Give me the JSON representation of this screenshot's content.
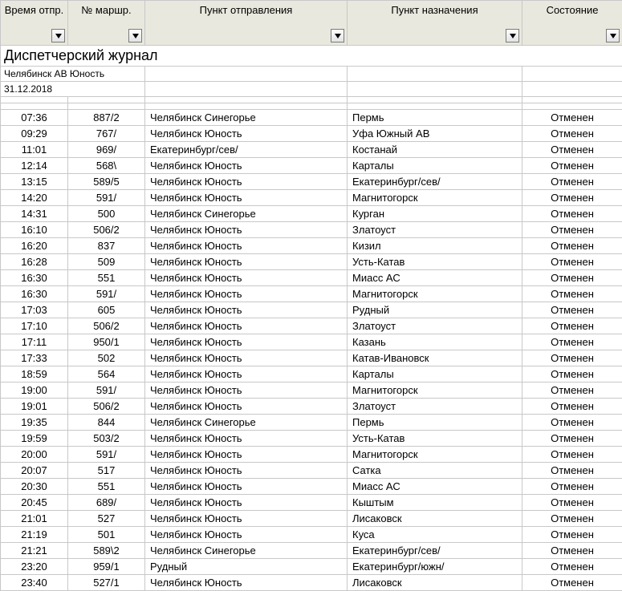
{
  "header": {
    "title": "Диспетчерский журнал",
    "station": "Челябинск АВ Юность",
    "date": "31.12.2018"
  },
  "columns": {
    "time": "Время отпр.",
    "route": "№ маршр.",
    "departure": "Пункт отправления",
    "destination": "Пункт назначения",
    "status": "Состояние"
  },
  "chart_data": {
    "type": "table",
    "columns": [
      "Время отпр.",
      "№ маршр.",
      "Пункт отправления",
      "Пункт назначения",
      "Состояние"
    ],
    "rows": [
      {
        "time": "07:36",
        "route": "887/2",
        "dep": "Челябинск Синегорье",
        "dest": "Пермь",
        "status": "Отменен"
      },
      {
        "time": "09:29",
        "route": "767/",
        "dep": "Челябинск Юность",
        "dest": "Уфа Южный АВ",
        "status": "Отменен"
      },
      {
        "time": "11:01",
        "route": "969/",
        "dep": "Екатеринбург/сев/",
        "dest": "Костанай",
        "status": "Отменен"
      },
      {
        "time": "12:14",
        "route": "568\\",
        "dep": "Челябинск Юность",
        "dest": "Карталы",
        "status": "Отменен"
      },
      {
        "time": "13:15",
        "route": "589/5",
        "dep": "Челябинск Юность",
        "dest": "Екатеринбург/сев/",
        "status": "Отменен"
      },
      {
        "time": "14:20",
        "route": "591/",
        "dep": "Челябинск Юность",
        "dest": "Магнитогорск",
        "status": "Отменен"
      },
      {
        "time": "14:31",
        "route": "500",
        "dep": "Челябинск Синегорье",
        "dest": "Курган",
        "status": "Отменен"
      },
      {
        "time": "16:10",
        "route": "506/2",
        "dep": "Челябинск Юность",
        "dest": "Златоуст",
        "status": "Отменен"
      },
      {
        "time": "16:20",
        "route": "837",
        "dep": "Челябинск Юность",
        "dest": "Кизил",
        "status": "Отменен"
      },
      {
        "time": "16:28",
        "route": "509",
        "dep": "Челябинск Юность",
        "dest": "Усть-Катав",
        "status": "Отменен"
      },
      {
        "time": "16:30",
        "route": "551",
        "dep": "Челябинск Юность",
        "dest": "Миасс АС",
        "status": "Отменен"
      },
      {
        "time": "16:30",
        "route": "591/",
        "dep": "Челябинск Юность",
        "dest": "Магнитогорск",
        "status": "Отменен"
      },
      {
        "time": "17:03",
        "route": "605",
        "dep": "Челябинск Юность",
        "dest": "Рудный",
        "status": "Отменен"
      },
      {
        "time": "17:10",
        "route": "506/2",
        "dep": "Челябинск Юность",
        "dest": "Златоуст",
        "status": "Отменен"
      },
      {
        "time": "17:11",
        "route": "950/1",
        "dep": "Челябинск Юность",
        "dest": "Казань",
        "status": "Отменен"
      },
      {
        "time": "17:33",
        "route": "502",
        "dep": "Челябинск Юность",
        "dest": "Катав-Ивановск",
        "status": "Отменен"
      },
      {
        "time": "18:59",
        "route": "564",
        "dep": "Челябинск Юность",
        "dest": "Карталы",
        "status": "Отменен"
      },
      {
        "time": "19:00",
        "route": "591/",
        "dep": "Челябинск Юность",
        "dest": "Магнитогорск",
        "status": "Отменен"
      },
      {
        "time": "19:01",
        "route": "506/2",
        "dep": "Челябинск Юность",
        "dest": "Златоуст",
        "status": "Отменен"
      },
      {
        "time": "19:35",
        "route": "844",
        "dep": "Челябинск Синегорье",
        "dest": "Пермь",
        "status": "Отменен"
      },
      {
        "time": "19:59",
        "route": "503/2",
        "dep": "Челябинск Юность",
        "dest": "Усть-Катав",
        "status": "Отменен"
      },
      {
        "time": "20:00",
        "route": "591/",
        "dep": "Челябинск Юность",
        "dest": "Магнитогорск",
        "status": "Отменен"
      },
      {
        "time": "20:07",
        "route": "517",
        "dep": "Челябинск Юность",
        "dest": "Сатка",
        "status": "Отменен"
      },
      {
        "time": "20:30",
        "route": "551",
        "dep": "Челябинск Юность",
        "dest": "Миасс АС",
        "status": "Отменен"
      },
      {
        "time": "20:45",
        "route": "689/",
        "dep": "Челябинск Юность",
        "dest": "Кыштым",
        "status": "Отменен"
      },
      {
        "time": "21:01",
        "route": "527",
        "dep": "Челябинск Юность",
        "dest": "Лисаковск",
        "status": "Отменен"
      },
      {
        "time": "21:19",
        "route": "501",
        "dep": "Челябинск Юность",
        "dest": "Куса",
        "status": "Отменен"
      },
      {
        "time": "21:21",
        "route": "589\\2",
        "dep": "Челябинск Синегорье",
        "dest": "Екатеринбург/сев/",
        "status": "Отменен"
      },
      {
        "time": "23:20",
        "route": "959/1",
        "dep": "Рудный",
        "dest": "Екатеринбург/южн/",
        "status": "Отменен"
      },
      {
        "time": "23:40",
        "route": "527/1",
        "dep": "Челябинск Юность",
        "dest": "Лисаковск",
        "status": "Отменен"
      }
    ]
  }
}
